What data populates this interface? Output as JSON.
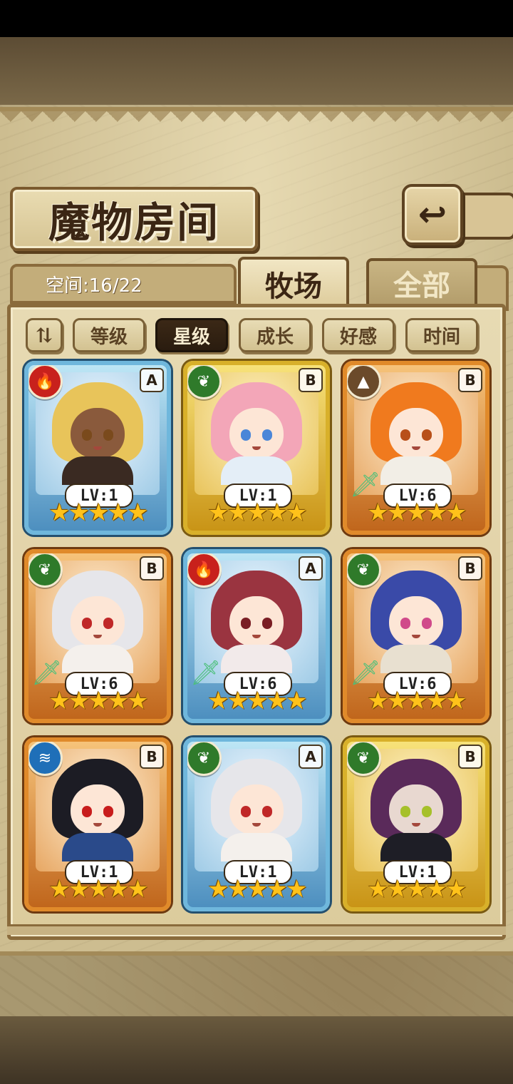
{
  "header": {
    "title": "魔物房间",
    "back_icon": "↩"
  },
  "space": {
    "label": "空间:16/22"
  },
  "tabs": [
    {
      "label": "牧场",
      "active": true
    },
    {
      "label": "全部",
      "active": false
    }
  ],
  "sort": {
    "toggle_icon": "⇅",
    "options": [
      {
        "label": "等级",
        "active": false
      },
      {
        "label": "星级",
        "active": true
      },
      {
        "label": "成长",
        "active": false
      },
      {
        "label": "好感",
        "active": false
      },
      {
        "label": "时间",
        "active": false
      }
    ]
  },
  "cards": [
    {
      "frame": "blue",
      "element": "fire",
      "element_color": "#c8211c",
      "element_icon": "🔥",
      "rank": "A",
      "level": "LV:1",
      "stars": 5,
      "hair": "#e8c45a",
      "eye": "#7a4a1c",
      "body": "#3a2a22",
      "skin": "#8a5a3c",
      "sword": false
    },
    {
      "frame": "gold",
      "element": "leaf",
      "element_color": "#2f7a2a",
      "element_icon": "❦",
      "rank": "B",
      "level": "LV:1",
      "stars": 5,
      "hair": "#f3a6b8",
      "eye": "#4a86d8",
      "body": "#e4eef7",
      "skin": "#fde6d6",
      "sword": false
    },
    {
      "frame": "orange",
      "element": "earth",
      "element_color": "#6b4a2a",
      "element_icon": "▲",
      "rank": "B",
      "level": "LV:6",
      "stars": 5,
      "hair": "#f07a1e",
      "eye": "#b8501a",
      "body": "#f2eee6",
      "skin": "#fde6d6",
      "sword": true
    },
    {
      "frame": "orange",
      "element": "leaf",
      "element_color": "#2f7a2a",
      "element_icon": "❦",
      "rank": "B",
      "level": "LV:6",
      "stars": 5,
      "hair": "#e6e6ea",
      "eye": "#c02828",
      "body": "#f4f0ec",
      "skin": "#fde6d6",
      "sword": true
    },
    {
      "frame": "blue",
      "element": "fire",
      "element_color": "#c8211c",
      "element_icon": "🔥",
      "rank": "A",
      "level": "LV:6",
      "stars": 5,
      "hair": "#9a3440",
      "eye": "#7a1e24",
      "body": "#f2eaea",
      "skin": "#fde6d6",
      "sword": true
    },
    {
      "frame": "orange",
      "element": "leaf",
      "element_color": "#2f7a2a",
      "element_icon": "❦",
      "rank": "B",
      "level": "LV:6",
      "stars": 5,
      "hair": "#3a4aa8",
      "eye": "#d04a8a",
      "body": "#e8e0d0",
      "skin": "#fde6d6",
      "sword": true
    },
    {
      "frame": "orange",
      "element": "water",
      "element_color": "#1f6fb8",
      "element_icon": "≋",
      "rank": "B",
      "level": "LV:1",
      "stars": 5,
      "hair": "#1c1c24",
      "eye": "#c81c1c",
      "body": "#2a4a8a",
      "skin": "#fde6d6",
      "sword": false
    },
    {
      "frame": "blue",
      "element": "leaf",
      "element_color": "#2f7a2a",
      "element_icon": "❦",
      "rank": "A",
      "level": "LV:1",
      "stars": 5,
      "hair": "#e6e6ea",
      "eye": "#c02828",
      "body": "#f4f0ec",
      "skin": "#fde6d6",
      "sword": false
    },
    {
      "frame": "gold",
      "element": "leaf",
      "element_color": "#2f7a2a",
      "element_icon": "❦",
      "rank": "B",
      "level": "LV:1",
      "stars": 5,
      "hair": "#5a2a5a",
      "eye": "#a6c02a",
      "body": "#1e1e26",
      "skin": "#e8d8d0",
      "sword": false
    }
  ]
}
